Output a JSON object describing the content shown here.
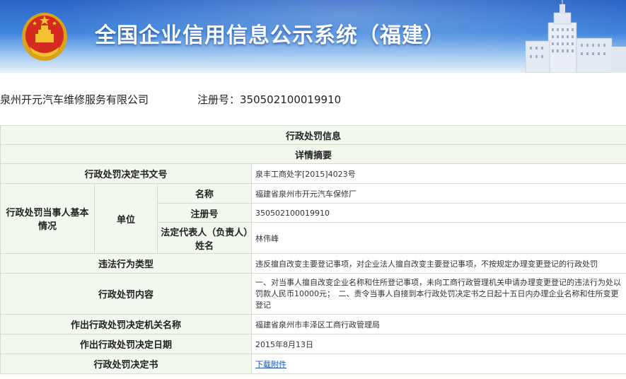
{
  "header": {
    "title": "全国企业信用信息公示系统（福建）"
  },
  "company": {
    "name": "泉州开元汽车维修服务有限公司",
    "reg_label_value": "注册号：350502100019910"
  },
  "section": {
    "title": "行政处罚信息",
    "subtitle": "详情摘要"
  },
  "fields": {
    "decision_no_label": "行政处罚决定书文号",
    "decision_no": "泉丰工商处字[2015]4023号",
    "party_label": "行政处罚当事人基本情况",
    "unit_label": "单位",
    "name_label": "名称",
    "name": "福建省泉州市开元汽车保修厂",
    "reg_no_label": "注册号",
    "reg_no": "350502100019910",
    "legal_rep_label": "法定代表人（负责人）姓名",
    "legal_rep": "林伟峰",
    "violation_type_label": "违法行为类型",
    "violation_type": "违反擅自改变主要登记事项，对企业法人擅自改变主要登记事项，不按规定办理变更登记的行政处罚",
    "content_label": "行政处罚内容",
    "content": "一、对当事人擅自改变企业名称和住所登记事项，未向工商行政管理机关申请办理变更登记的违法行为处以罚款人民币10000元；　二、责令当事人自接到本行政处罚决定书之日起十五日内办理企业名称和住所变更登记",
    "authority_label": "作出行政处罚决定机关名称",
    "authority": "福建省泉州市丰泽区工商行政管理局",
    "date_label": "作出行政处罚决定日期",
    "date": "2015年8月13日",
    "doc_label": "行政处罚决定书",
    "doc_link": "下载附件"
  },
  "colors": {
    "banner_top": "#2a64c6",
    "label_bg": "#f3f8ef",
    "border": "#d4dccb",
    "link": "#1a4fb5"
  }
}
